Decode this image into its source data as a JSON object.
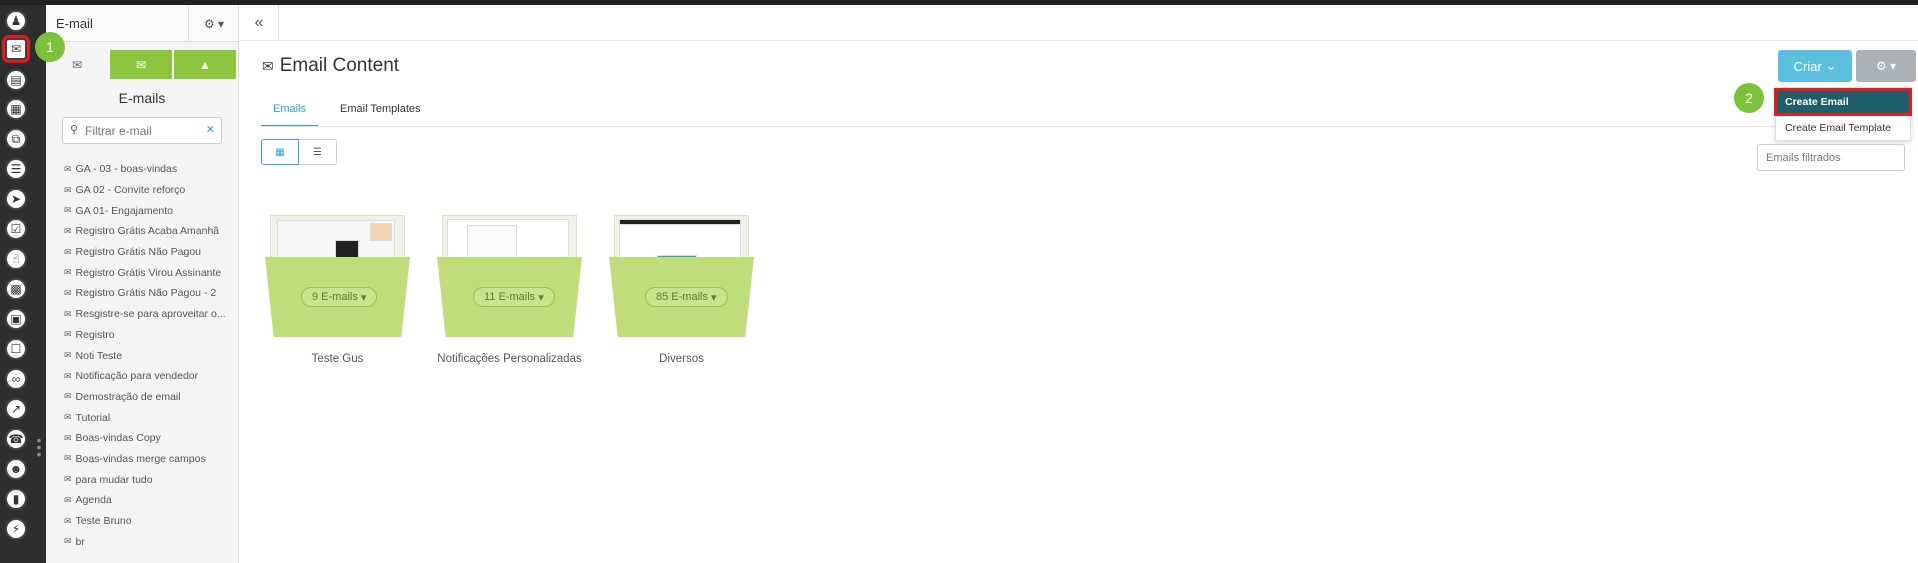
{
  "sidebar": {
    "header_title": "E-mail",
    "title": "E-mails",
    "filter_placeholder": "Filtrar e-mail",
    "items": [
      "GA - 03 - boas-vindas",
      "GA 02 - Convite reforço",
      "GA 01- Engajamento",
      "Registro Grátis Acaba Amanhã",
      "Registro Grátis Não Pagou",
      "Registro Grátis Virou Assinante",
      "Registro Grátis Não Pagou - 2",
      "Resgistre-se para aproveitar o...",
      "Registro",
      "Noti Teste",
      "Notificação para vendedor",
      "Demostração de email",
      "Tutorial",
      "Boas-vindas Copy",
      "Boas-vindas merge campos",
      "para mudar tudo",
      "Agenda",
      "Teste Bruno",
      "br"
    ]
  },
  "main": {
    "title": "Email Content",
    "tabs": [
      "Emails",
      "Email Templates"
    ],
    "criar_label": "Criar",
    "dropdown": [
      "Create Email",
      "Create Email Template"
    ],
    "filter_placeholder": "Emails filtrados",
    "folders": [
      {
        "count": "9 E-mails",
        "name": "Teste Gus"
      },
      {
        "count": "11 E-mails",
        "name": "Notificações Personalizadas"
      },
      {
        "count": "85 E-mails",
        "name": "Diversos"
      }
    ]
  },
  "badges": [
    "1",
    "2"
  ],
  "colors": {
    "accent": "#2aa3c7",
    "green": "#8cc63f",
    "highlight": "#1f5f6c",
    "annotation": "#e21b1b"
  }
}
